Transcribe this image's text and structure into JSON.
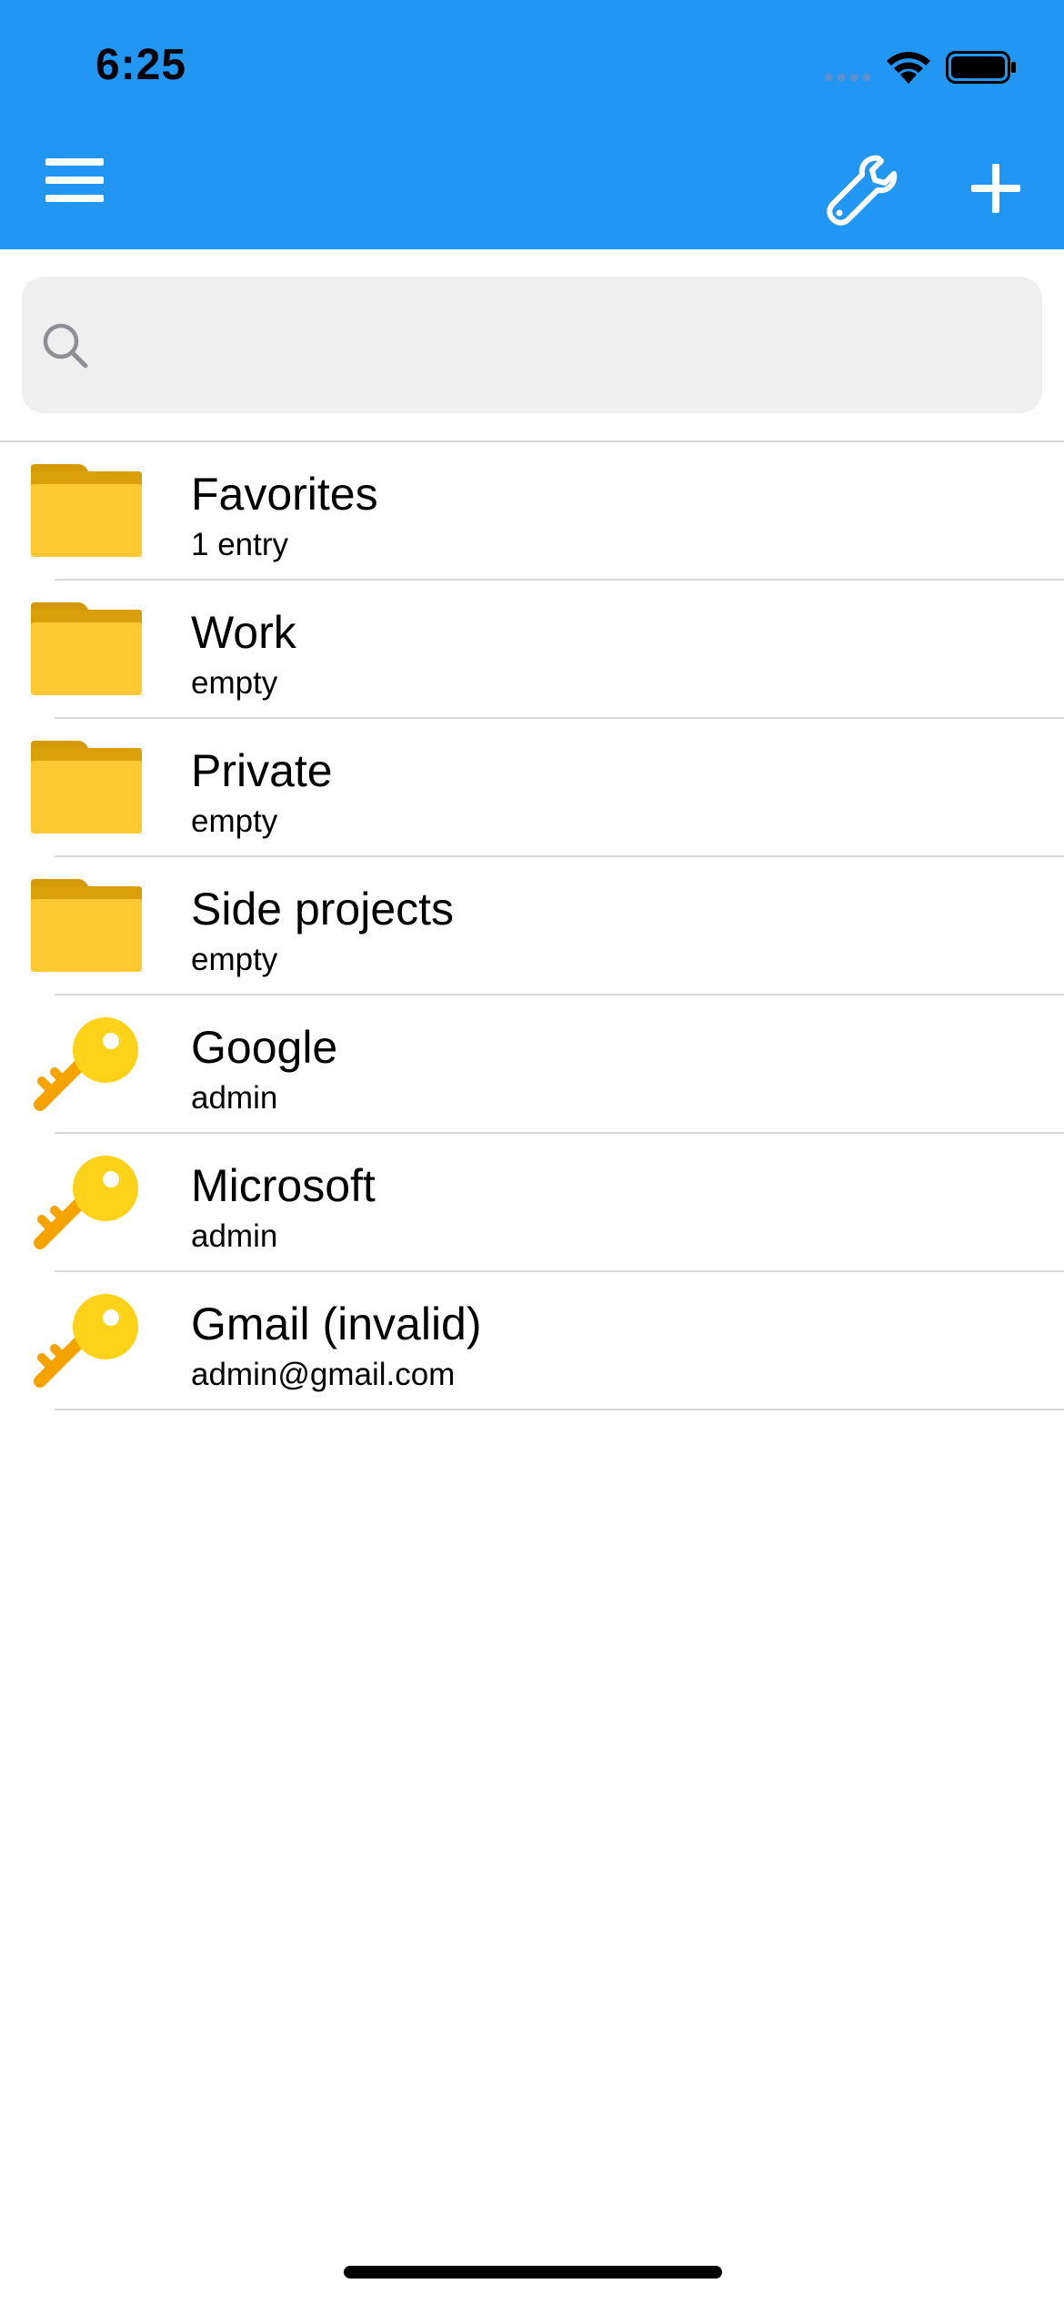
{
  "status_bar": {
    "time": "6:25"
  },
  "toolbar": {
    "menu_icon": "hamburger-menu-icon",
    "settings_icon": "wrench-icon",
    "add_icon": "plus-icon"
  },
  "search": {
    "placeholder": "",
    "value": ""
  },
  "theme": {
    "accent": "#2196F3",
    "folder": "#FFC933",
    "key": "#FFD21A"
  },
  "items": [
    {
      "type": "folder",
      "title": "Favorites",
      "subtitle": "1 entry"
    },
    {
      "type": "folder",
      "title": "Work",
      "subtitle": "empty"
    },
    {
      "type": "folder",
      "title": "Private",
      "subtitle": "empty"
    },
    {
      "type": "folder",
      "title": "Side projects",
      "subtitle": "empty"
    },
    {
      "type": "entry",
      "title": "Google",
      "subtitle": "admin"
    },
    {
      "type": "entry",
      "title": "Microsoft",
      "subtitle": "admin"
    },
    {
      "type": "entry",
      "title": "Gmail (invalid)",
      "subtitle": "admin@gmail.com"
    }
  ]
}
